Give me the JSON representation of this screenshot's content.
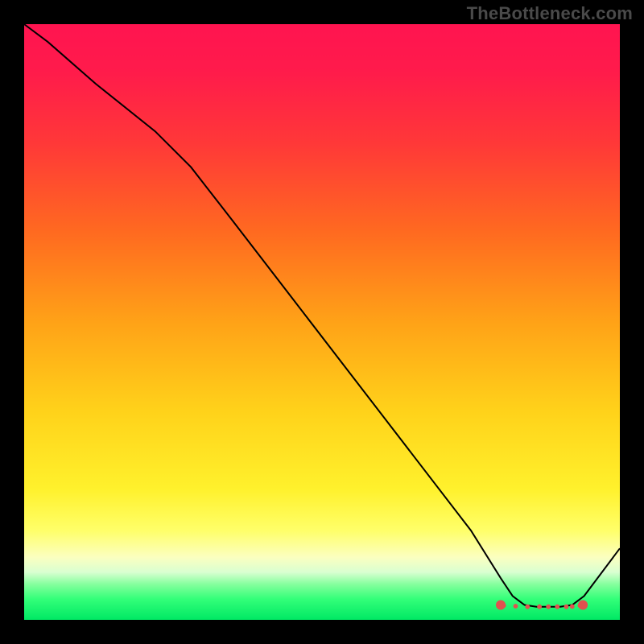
{
  "watermark": "TheBottleneck.com",
  "chart_data": {
    "type": "line",
    "title": "",
    "xlabel": "",
    "ylabel": "",
    "xlim": [
      0,
      100
    ],
    "ylim": [
      0,
      100
    ],
    "x": [
      0,
      4,
      12,
      22,
      28,
      35,
      45,
      55,
      65,
      75,
      80,
      82,
      84,
      86,
      88,
      90,
      92,
      94,
      100
    ],
    "values": [
      100,
      97,
      90,
      82,
      76,
      67,
      54,
      41,
      28,
      15,
      7,
      4,
      2.5,
      2.2,
      2.2,
      2.2,
      2.5,
      4,
      12
    ],
    "recommended_segment": {
      "x": [
        80.5,
        82.5,
        84.5,
        86.5,
        88,
        89.5,
        91,
        92,
        93.3
      ],
      "y": [
        2.4,
        2.3,
        2.2,
        2.2,
        2.2,
        2.2,
        2.2,
        2.25,
        2.4
      ]
    },
    "recommended_endpoints": {
      "x": [
        80,
        93.8
      ],
      "y": [
        2.5,
        2.5
      ]
    },
    "gradient_stops": [
      {
        "pos": 0,
        "color": "#ff1450"
      },
      {
        "pos": 20,
        "color": "#ff3838"
      },
      {
        "pos": 50,
        "color": "#ffa217"
      },
      {
        "pos": 78,
        "color": "#fff12c"
      },
      {
        "pos": 92,
        "color": "#d9ffd1"
      },
      {
        "pos": 100,
        "color": "#00e864"
      }
    ]
  }
}
